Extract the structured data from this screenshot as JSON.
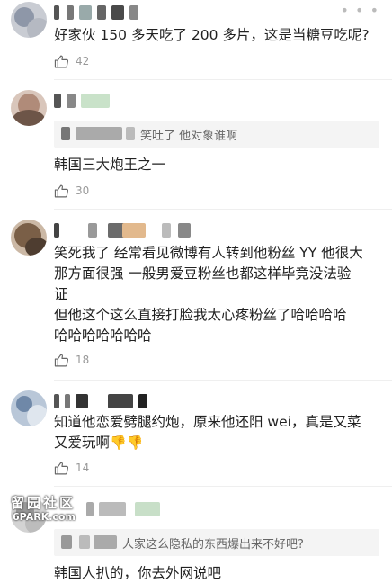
{
  "comments": [
    {
      "text_lines": [
        "好家伙 150 多天吃了 200 多片，这是当糖豆吃呢?"
      ],
      "likes": "42"
    },
    {
      "reply": "笑吐了 他对象谁啊",
      "text_lines": [
        "韩国三大炮王之一"
      ],
      "likes": "30"
    },
    {
      "text_lines": [
        "笑死我了 经常看见微博有人转到他粉丝 YY 他很大",
        "那方面很强 一般男爱豆粉丝也都这样毕竟没法验",
        "证",
        "但他这个这么直接打脸我太心疼粉丝了哈哈哈哈",
        "哈哈哈哈哈哈哈"
      ],
      "likes": "18"
    },
    {
      "text_lines": [
        "知道他恋爱劈腿约炮，原来他还阳 wei，真是又菜",
        "又爱玩啊"
      ],
      "emoji_trailing": "👎👎",
      "likes": "14"
    },
    {
      "reply": "人家这么隐私的东西爆出来不好吧?",
      "text_lines": [
        "韩国人扒的，你去外网说吧"
      ]
    }
  ],
  "watermark": {
    "top": "留园社区",
    "bottom": "6PARK.com"
  },
  "icons": {
    "like": "thumbs-up-icon",
    "more": "more-dots-icon"
  },
  "colors": {
    "text": "#222222",
    "meta": "#999999",
    "reply_bg": "#f4f4f4"
  }
}
